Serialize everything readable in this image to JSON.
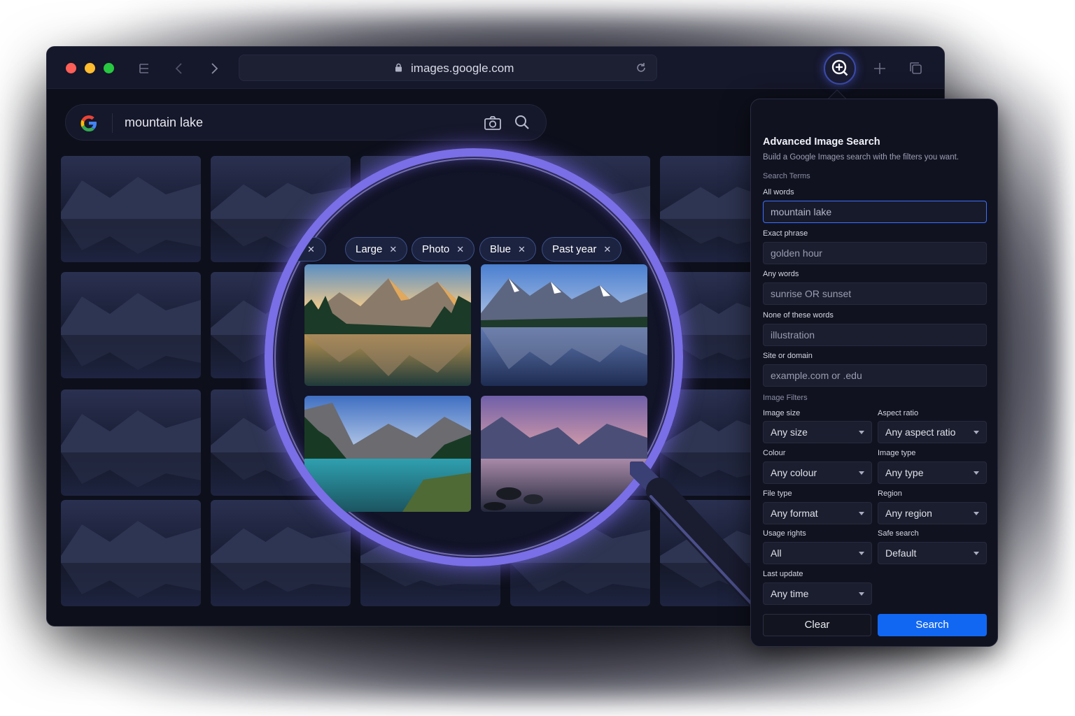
{
  "browser": {
    "url": "images.google.com"
  },
  "search": {
    "query": "mountain lake"
  },
  "filter_chips": [
    {
      "label": "Large"
    },
    {
      "label": "Photo"
    },
    {
      "label": "Blue"
    },
    {
      "label": "Past year"
    }
  ],
  "panel": {
    "title": "Advanced Image Search",
    "subtitle": "Build a Google Images search with the filters you want.",
    "section_terms": "Search Terms",
    "fields": {
      "all_words": {
        "label": "All words",
        "value": "mountain lake"
      },
      "exact_phrase": {
        "label": "Exact phrase",
        "placeholder": "golden hour"
      },
      "any_words": {
        "label": "Any words",
        "placeholder": "sunrise OR sunset"
      },
      "none_words": {
        "label": "None of these words",
        "placeholder": "illustration"
      },
      "site": {
        "label": "Site or domain",
        "placeholder": "example.com or .edu"
      }
    },
    "section_filters": "Image Filters",
    "filters": {
      "image_size": {
        "label": "Image size",
        "value": "Any size"
      },
      "aspect_ratio": {
        "label": "Aspect ratio",
        "value": "Any aspect ratio"
      },
      "colour": {
        "label": "Colour",
        "value": "Any colour"
      },
      "image_type": {
        "label": "Image type",
        "value": "Any type"
      },
      "file_type": {
        "label": "File type",
        "value": "Any format"
      },
      "region": {
        "label": "Region",
        "value": "Any region"
      },
      "usage_rights": {
        "label": "Usage rights",
        "value": "All"
      },
      "safe_search": {
        "label": "Safe search",
        "value": "Default"
      },
      "last_update": {
        "label": "Last update",
        "value": "Any time"
      }
    },
    "clear_label": "Clear",
    "search_label": "Search"
  },
  "colors": {
    "accent": "#1167f2",
    "window_bg": "#0d0f1b",
    "lens_ring": "#7a6fe6",
    "traffic_red": "#ff5f57",
    "traffic_yellow": "#febc2e",
    "traffic_green": "#28c840"
  },
  "icons": {
    "menu": "menu-icon",
    "back": "chevron-left-icon",
    "forward": "chevron-right-icon",
    "lock": "lock-icon",
    "reload": "reload-icon",
    "extension": "zoom-in-icon",
    "new_tab": "plus-icon",
    "tabs": "tabs-icon",
    "camera": "camera-icon",
    "search": "search-icon"
  }
}
